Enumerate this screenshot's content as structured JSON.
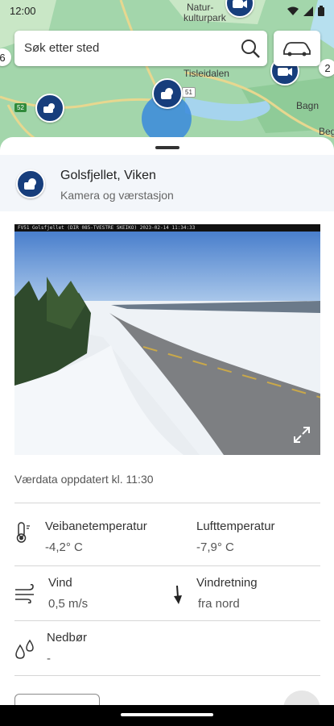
{
  "status_bar": {
    "time": "12:00"
  },
  "map": {
    "labels": {
      "natur": "Natur-",
      "kulturpark": "kulturpark",
      "tisleidalen": "Tisleidalen",
      "bagn": "Bagn",
      "beg": "Beg"
    },
    "road_number": "52",
    "marker_number": "51",
    "cluster_count_left": "6",
    "cluster_count_right": "2"
  },
  "search": {
    "placeholder": "Søk etter sted"
  },
  "location": {
    "title": "Golsfjellet, Viken",
    "subtitle": "Kamera og værstasjon"
  },
  "camera": {
    "caption": "FV51 Golsfjellet  (DIR 085-TVESTRE  SKEIKO)  2023-02-14 11:34:33"
  },
  "weather": {
    "updated": "Værdata oppdatert kl. 11:30",
    "road_temp_label": "Veibanetemperatur",
    "road_temp_value": "-4,2° C",
    "air_temp_label": "Lufttemperatur",
    "air_temp_value": "-7,9° C",
    "wind_label": "Vind",
    "wind_value": "0,5 m/s",
    "wind_dir_label": "Vindretning",
    "wind_dir_value": "fra nord",
    "precip_label": "Nedbør",
    "precip_value": "-"
  },
  "colors": {
    "brand": "#173e7c",
    "halo": "#3a8adc",
    "map_green": "#9fd3a8"
  }
}
